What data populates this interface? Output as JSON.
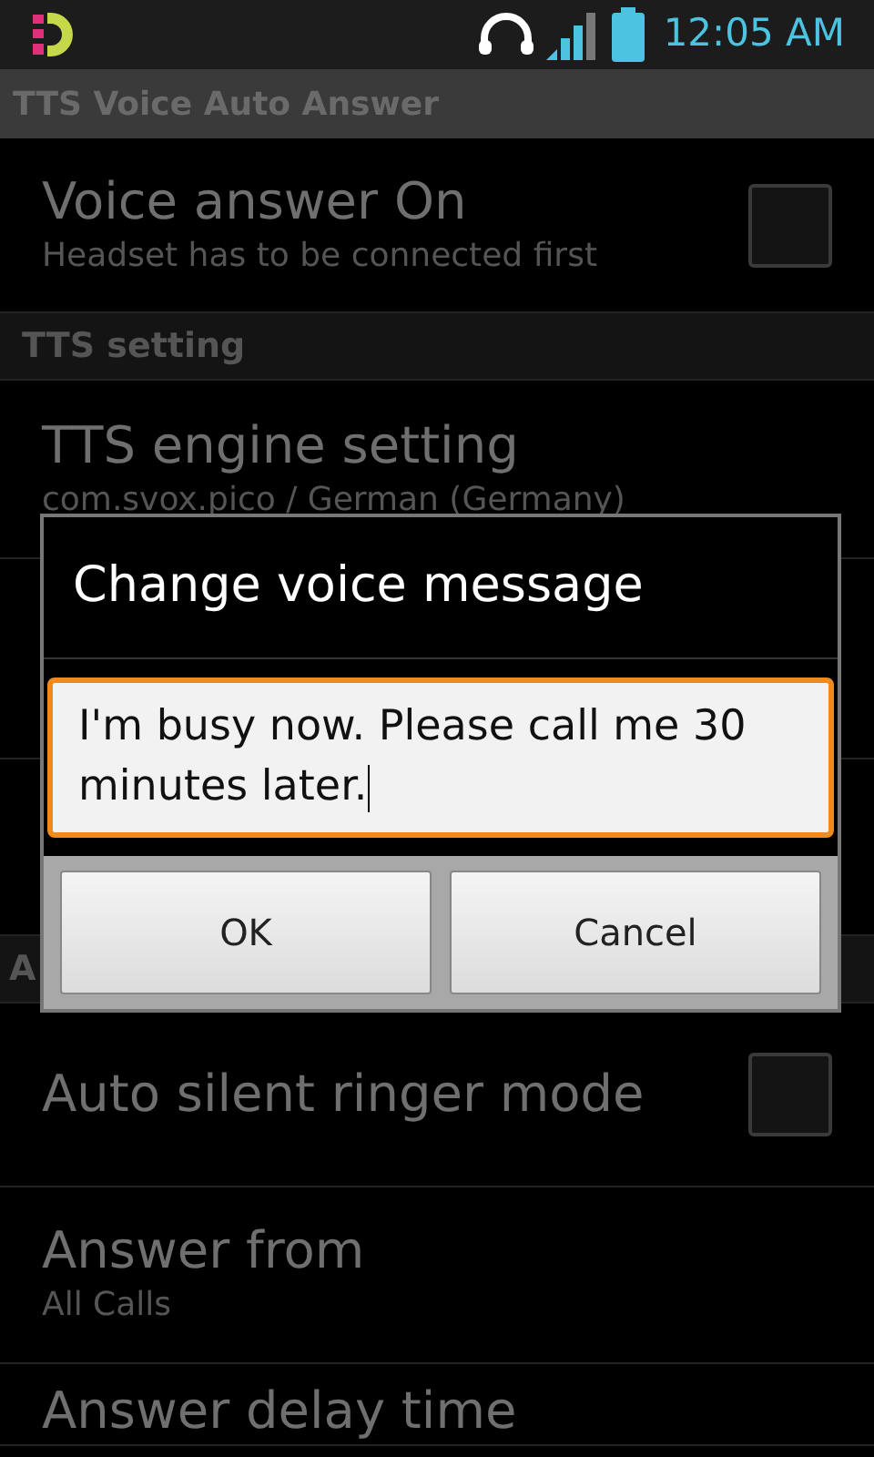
{
  "status_bar": {
    "time": "12:05 AM"
  },
  "window": {
    "title": "TTS Voice Auto Answer"
  },
  "list": [
    {
      "kind": "checkbox",
      "title": "Voice answer On",
      "subtitle": "Headset has to be connected first",
      "checked": false
    },
    {
      "kind": "header",
      "title": "TTS setting"
    },
    {
      "kind": "item",
      "title": "TTS engine setting",
      "subtitle": "com.svox.pico / German (Germany)"
    },
    {
      "kind": "item"
    },
    {
      "kind": "item"
    },
    {
      "kind": "header",
      "title": "A"
    },
    {
      "kind": "checkbox",
      "title": "Auto silent ringer mode",
      "checked": false
    },
    {
      "kind": "item",
      "title": "Answer from",
      "subtitle": "All Calls"
    },
    {
      "kind": "item",
      "title": "Answer delay time"
    }
  ],
  "dialog": {
    "title": "Change voice message",
    "value": "I'm busy now. Please call me 30 minutes later.",
    "buttons": [
      "OK",
      "Cancel"
    ]
  }
}
